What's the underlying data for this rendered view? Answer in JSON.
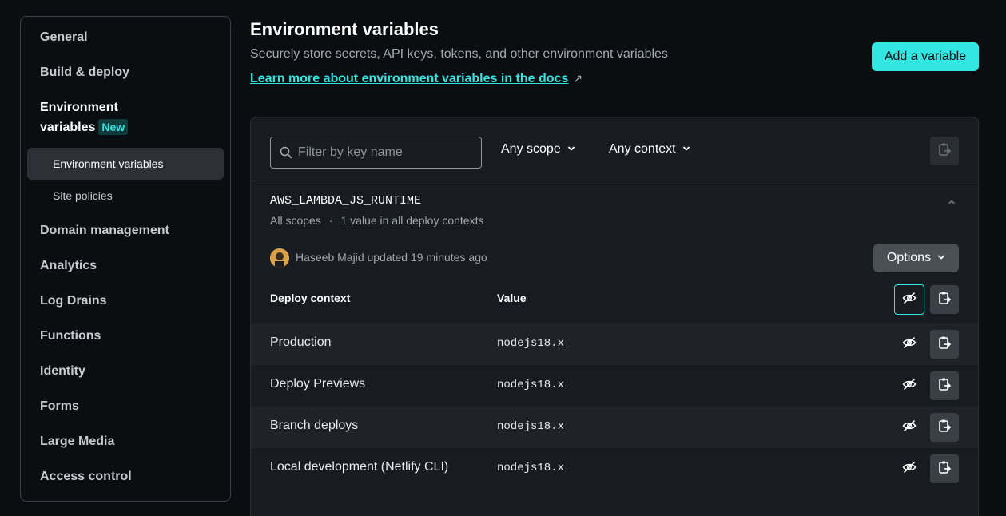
{
  "sidebar": {
    "items": [
      {
        "label": "General"
      },
      {
        "label": "Build & deploy"
      },
      {
        "label_line1": "Environment",
        "label_line2": "variables",
        "badge": "New"
      },
      {
        "label": "Domain management"
      },
      {
        "label": "Analytics"
      },
      {
        "label": "Log Drains"
      },
      {
        "label": "Functions"
      },
      {
        "label": "Identity"
      },
      {
        "label": "Forms"
      },
      {
        "label": "Large Media"
      },
      {
        "label": "Access control"
      }
    ],
    "subitems": [
      {
        "label": "Environment variables",
        "active": true
      },
      {
        "label": "Site policies"
      }
    ]
  },
  "header": {
    "title": "Environment variables",
    "subtitle": "Securely store secrets, API keys, tokens, and other environment variables",
    "docs_link": "Learn more about environment variables in the docs",
    "add_button": "Add a variable"
  },
  "toolbar": {
    "search_placeholder": "Filter by key name",
    "scope_dropdown": "Any scope",
    "context_dropdown": "Any context"
  },
  "variable": {
    "name": "AWS_LAMBDA_JS_RUNTIME",
    "scopes": "All scopes",
    "summary": "1 value in all deploy contexts",
    "updated_by": "Haseeb Majid updated 19 minutes ago",
    "options_button": "Options",
    "columns": {
      "context": "Deploy context",
      "value": "Value"
    },
    "rows": [
      {
        "context": "Production",
        "value": "nodejs18.x"
      },
      {
        "context": "Deploy Previews",
        "value": "nodejs18.x"
      },
      {
        "context": "Branch deploys",
        "value": "nodejs18.x"
      },
      {
        "context": "Local development (Netlify CLI)",
        "value": "nodejs18.x"
      }
    ]
  },
  "colors": {
    "accent": "#32e6e2",
    "background": "#0b0e11",
    "card": "#181b20"
  },
  "icons": [
    "search-icon",
    "chevron-down-icon",
    "chevron-up-icon",
    "copy-to-clipboard-icon",
    "eye-slash-icon",
    "external-link-icon"
  ]
}
